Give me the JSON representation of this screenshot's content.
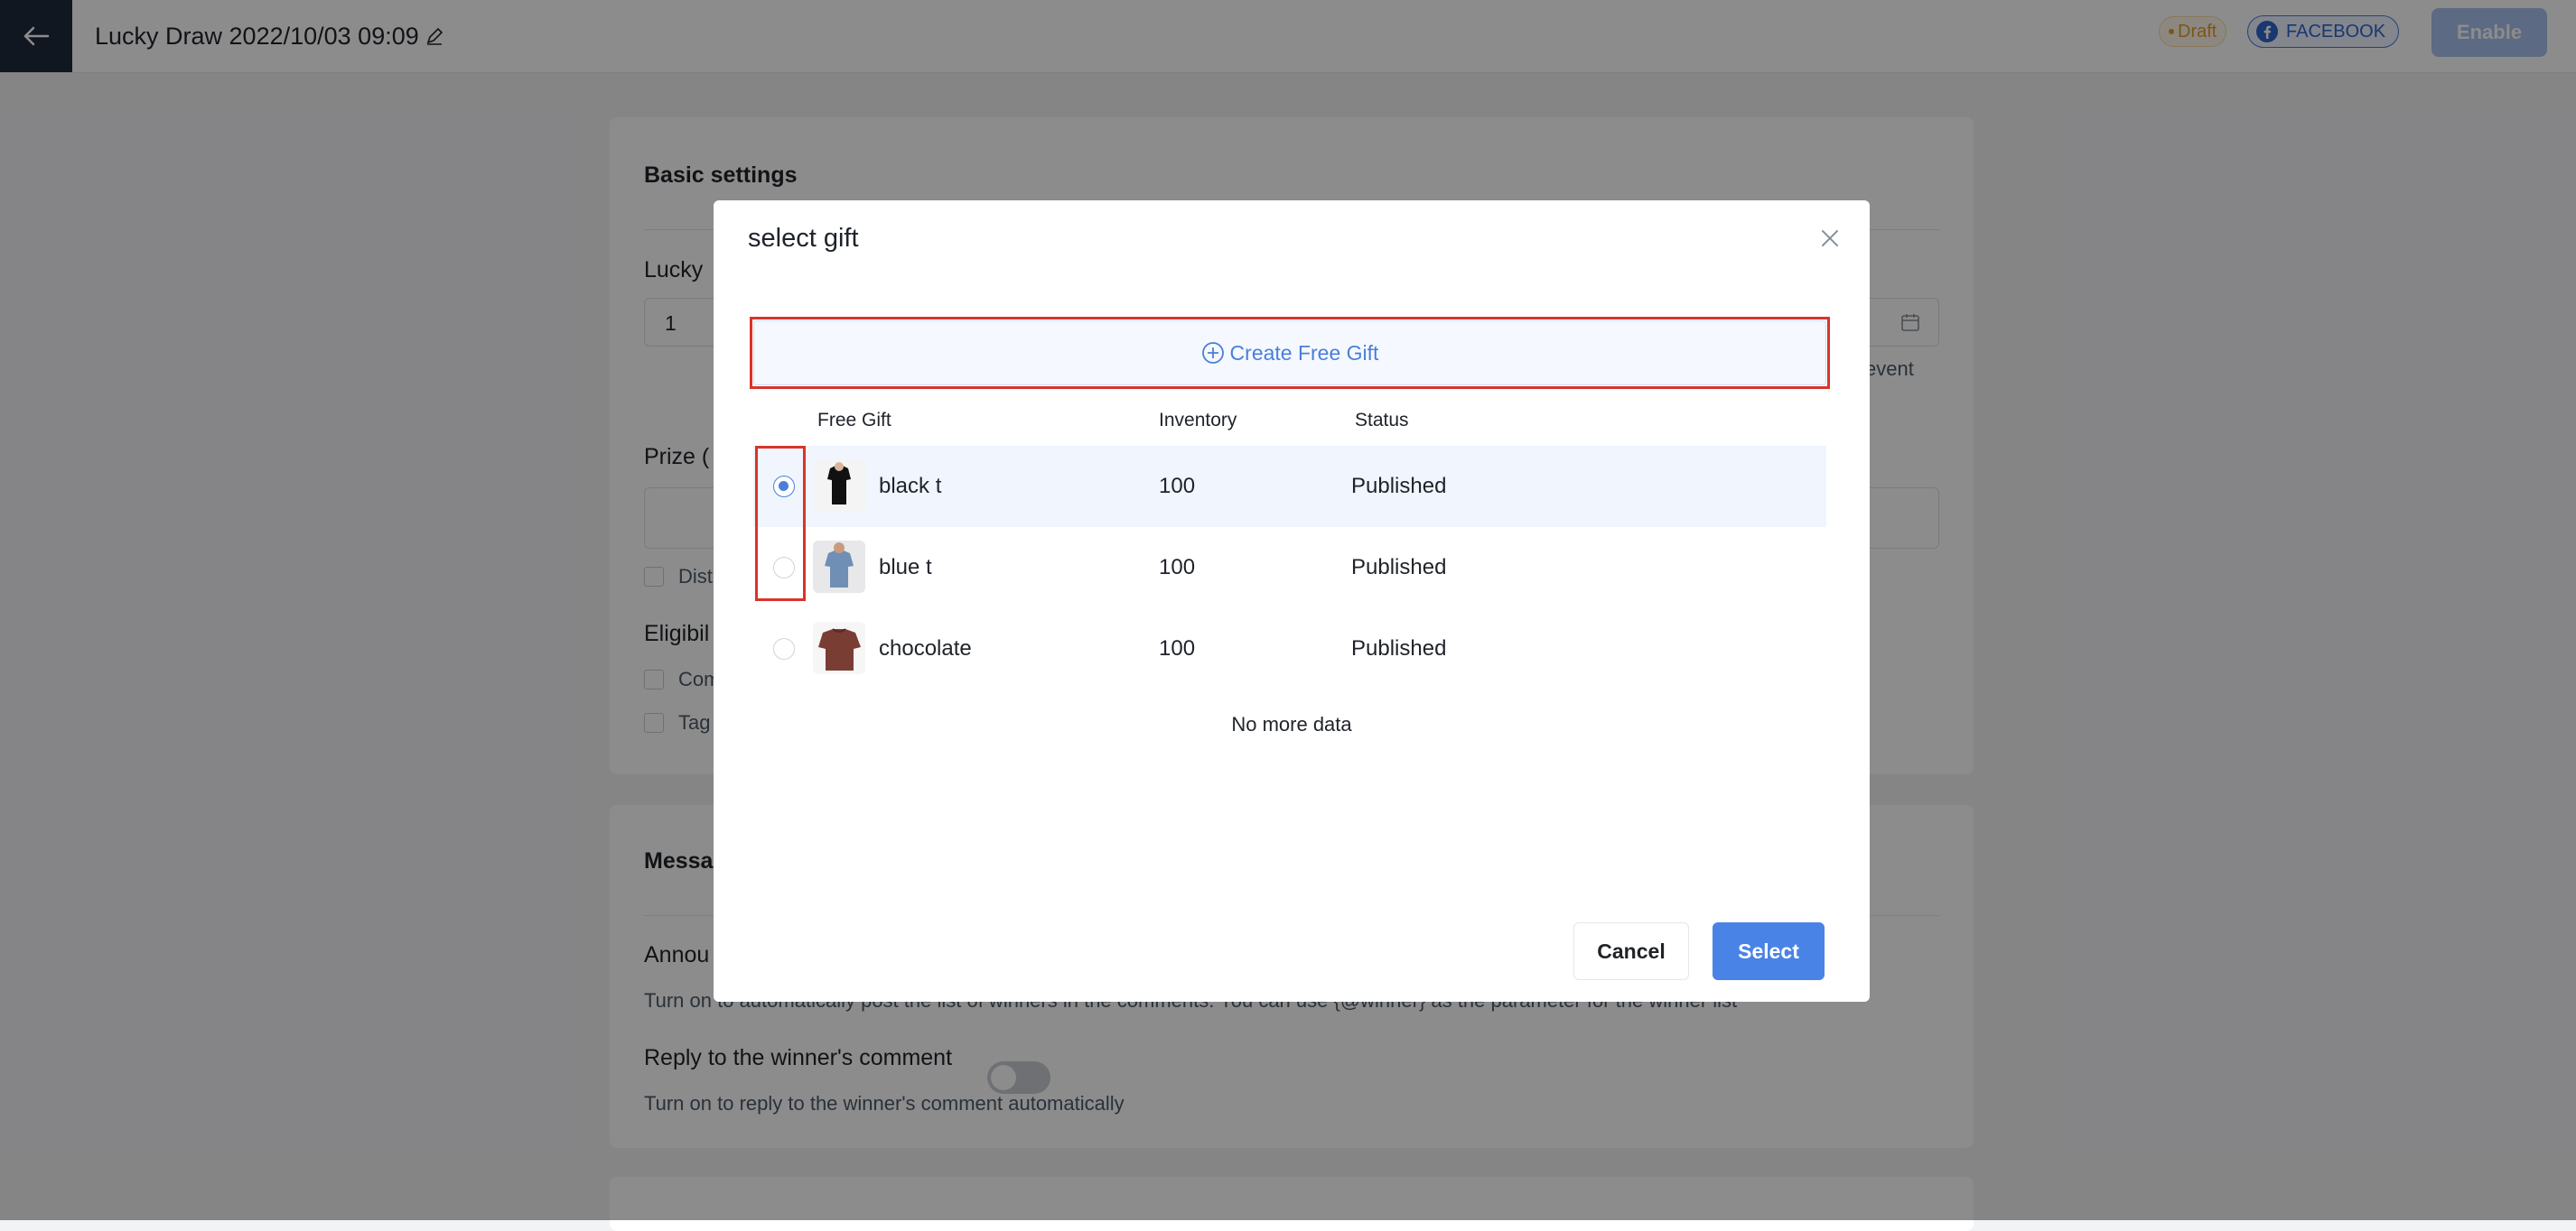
{
  "header": {
    "title": "Lucky Draw 2022/10/03 09:09",
    "status_badge": "Draft",
    "platform_badge": "FACEBOOK",
    "enable_label": "Enable"
  },
  "basic_settings": {
    "title": "Basic settings",
    "lucky_label": "Lucky",
    "lucky_value": "1",
    "event_hint": "event",
    "prize_label": "Prize (",
    "distribute_label": "Dist",
    "eligibility_label": "Eligibil",
    "condition_comment": "Com",
    "condition_tag": "Tag"
  },
  "message_settings": {
    "title": "Messa",
    "announce_label": "Annou",
    "announce_help": "Turn on to automatically post the list of winners in the comments. You can use {@winner} as the parameter for the winner list",
    "reply_label": "Reply to the winner's comment",
    "reply_help": "Turn on to reply to the winner's comment automatically",
    "reply_enabled": false
  },
  "modal": {
    "title": "select gift",
    "create_label": "Create Free Gift",
    "columns": [
      "Free Gift",
      "Inventory",
      "Status"
    ],
    "rows": [
      {
        "name": "black t",
        "inventory": "100",
        "status": "Published",
        "selected": true
      },
      {
        "name": "blue t",
        "inventory": "100",
        "status": "Published",
        "selected": false
      },
      {
        "name": "chocolate",
        "inventory": "100",
        "status": "Published",
        "selected": false
      }
    ],
    "no_more": "No more data",
    "cancel_label": "Cancel",
    "select_label": "Select"
  },
  "colors": {
    "primary": "#4a83e6",
    "header_dark": "#1f2a3c",
    "annotation_red": "#d9342b",
    "draft": "#e69b2a"
  }
}
